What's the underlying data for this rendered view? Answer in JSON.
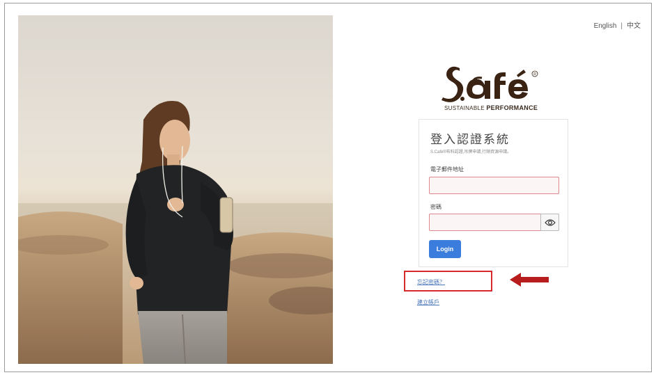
{
  "language_switch": {
    "english": "English",
    "separator": "|",
    "chinese": "中文"
  },
  "logo": {
    "tagline_light": "SUSTAINABLE",
    "tagline_bold": "PERFORMANCE"
  },
  "login_card": {
    "title": "登入認證系統",
    "description": "S.Café®布料認證,吊牌申請,行銷資源申請。",
    "email_label": "電子郵件地址",
    "email_value": "",
    "password_label": "密碼",
    "password_value": "",
    "login_button": "Login"
  },
  "links": {
    "forgot_password": "忘記密碼？",
    "create_account": "建立帳戶"
  },
  "colors": {
    "brand_brown": "#3b2314",
    "login_blue": "#3b7ddd",
    "error_border": "#e0888e",
    "annotation_red": "#d62a2a",
    "link_blue": "#4a74b8"
  }
}
